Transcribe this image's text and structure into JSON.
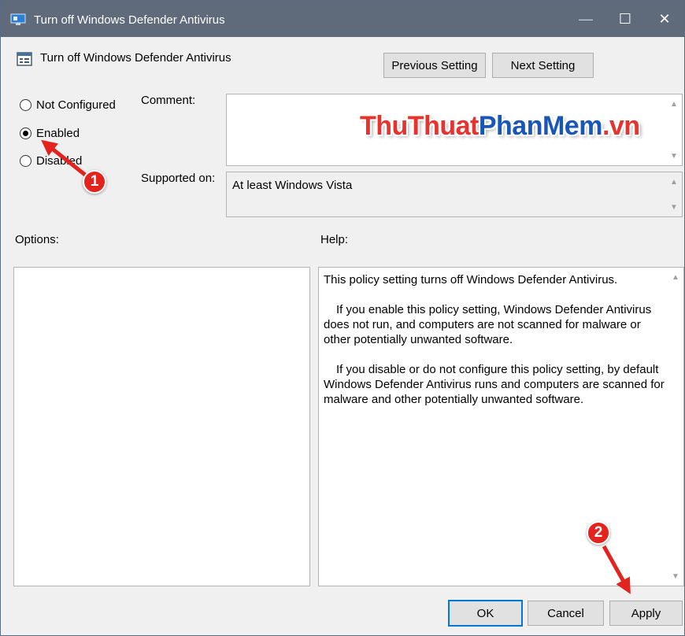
{
  "window": {
    "title": "Turn off Windows Defender Antivirus",
    "controls": {
      "minimize": "—",
      "maximize": "☐",
      "close": "✕"
    }
  },
  "header": {
    "title": "Turn off Windows Defender Antivirus",
    "previous_label": "Previous Setting",
    "next_label": "Next Setting"
  },
  "state": {
    "options": [
      {
        "label": "Not Configured",
        "checked": false
      },
      {
        "label": "Enabled",
        "checked": true
      },
      {
        "label": "Disabled",
        "checked": false
      }
    ]
  },
  "comment": {
    "label": "Comment:",
    "value": ""
  },
  "supported": {
    "label": "Supported on:",
    "value": "At least Windows Vista"
  },
  "options_panel": {
    "label": "Options:"
  },
  "help": {
    "label": "Help:",
    "paragraphs": [
      "This policy setting turns off Windows Defender Antivirus.",
      "If you enable this policy setting, Windows Defender Antivirus does not run, and computers are not scanned for malware or other potentially unwanted software.",
      "If you disable or do not configure this policy setting, by default Windows Defender Antivirus runs and computers are scanned for malware and other potentially unwanted software."
    ]
  },
  "footer": {
    "ok_label": "OK",
    "cancel_label": "Cancel",
    "apply_label": "Apply"
  },
  "annotations": {
    "step1": "1",
    "step2": "2"
  },
  "watermark": {
    "part1": "ThuThuat",
    "part2": "PhanMem",
    "part3": ".vn"
  },
  "colors": {
    "accent": "#0078d7",
    "badge": "#e3231e",
    "titlebar": "#5f6b7b"
  }
}
